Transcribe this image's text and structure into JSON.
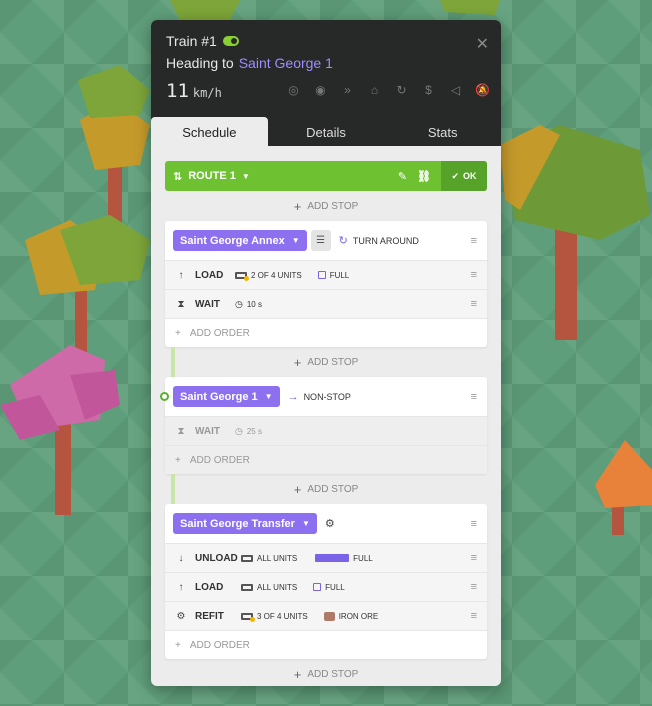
{
  "train": {
    "name": "Train #1",
    "heading_prefix": "Heading to",
    "destination": "Saint George 1",
    "speed": "11",
    "speed_unit": "km/h"
  },
  "toolbar_icons": [
    "target-icon",
    "eye-icon",
    "fast-forward-icon",
    "depot-icon",
    "refresh-icon",
    "no-money-icon",
    "reverse-icon",
    "mute-icon"
  ],
  "tabs": [
    "Schedule",
    "Details",
    "Stats"
  ],
  "route": {
    "name": "ROUTE 1",
    "ok_label": "OK"
  },
  "add_stop": "ADD STOP",
  "add_order": "ADD ORDER",
  "stops": [
    {
      "name": "Saint George Annex",
      "mode": "TURN AROUND",
      "orders": [
        {
          "icon": "↑",
          "name": "LOAD",
          "units": "2 OF 4 UNITS",
          "extra": "FULL",
          "checked": false
        },
        {
          "icon": "⧗",
          "name": "WAIT",
          "time": "10 s"
        }
      ]
    },
    {
      "name": "Saint George 1",
      "mode": "NON-STOP",
      "orders": [
        {
          "icon": "⧗",
          "name": "WAIT",
          "time": "25 s"
        }
      ]
    },
    {
      "name": "Saint George Transfer",
      "mode": "",
      "orders": [
        {
          "icon": "↓",
          "name": "UNLOAD",
          "units": "ALL UNITS",
          "extra": "FULL",
          "checked": true
        },
        {
          "icon": "↑",
          "name": "LOAD",
          "units": "ALL UNITS",
          "extra": "FULL",
          "checked": false
        },
        {
          "icon": "⚙",
          "name": "REFIT",
          "units": "3 OF 4 UNITS",
          "extra": "IRON ORE"
        }
      ]
    }
  ],
  "colors": {
    "accent": "#8c70f0",
    "route_green": "#6ec232",
    "header_bg": "#272828"
  }
}
